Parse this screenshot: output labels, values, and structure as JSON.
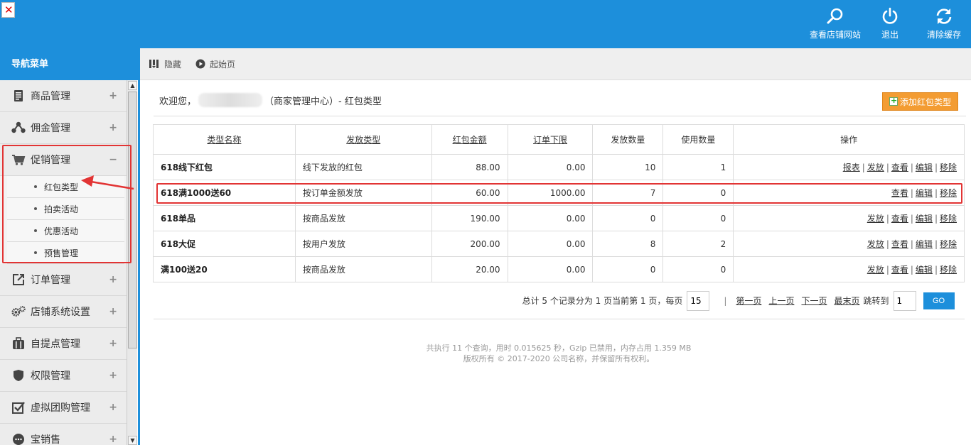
{
  "topbar": {
    "actions": [
      {
        "label": "查看店铺网站",
        "icon": "search-icon"
      },
      {
        "label": "退出",
        "icon": "power-icon"
      },
      {
        "label": "清除缓存",
        "icon": "refresh-icon"
      }
    ]
  },
  "nav": {
    "header": "导航菜单",
    "items": [
      {
        "label": "商品管理",
        "icon": "document-icon",
        "toggle": "+"
      },
      {
        "label": "佣金管理",
        "icon": "share-icon",
        "toggle": "+"
      },
      {
        "label": "促销管理",
        "icon": "cart-icon",
        "toggle": "−"
      },
      {
        "label": "订单管理",
        "icon": "export-icon",
        "toggle": "+"
      },
      {
        "label": "店铺系统设置",
        "icon": "gears-icon",
        "toggle": "+"
      },
      {
        "label": "自提点管理",
        "icon": "briefcase-icon",
        "toggle": "+"
      },
      {
        "label": "权限管理",
        "icon": "shield-icon",
        "toggle": "+"
      },
      {
        "label": "虚拟团购管理",
        "icon": "checkbox-icon",
        "toggle": "+"
      },
      {
        "label": "宝销售",
        "icon": "chat-icon",
        "toggle": "+"
      }
    ],
    "submenu": [
      "红包类型",
      "拍卖活动",
      "优惠活动",
      "预售管理"
    ]
  },
  "toolbar": {
    "hide_label": "隐藏",
    "home_label": "起始页"
  },
  "page": {
    "welcome_prefix": "欢迎您，",
    "welcome_suffix": "（商家管理中心）- 红包类型",
    "add_button": "添加红包类型"
  },
  "table": {
    "headers": [
      "类型名称",
      "发放类型",
      "红包金额",
      "订单下限",
      "发放数量",
      "使用数量",
      "操作"
    ],
    "rows": [
      {
        "name": "618线下红包",
        "type": "线下发放的红包",
        "amount": "88.00",
        "min": "0.00",
        "issued": "10",
        "used": "1",
        "ops": [
          "报表",
          "发放",
          "查看",
          "编辑",
          "移除"
        ]
      },
      {
        "name": "618满1000送60",
        "type": "按订单金额发放",
        "amount": "60.00",
        "min": "1000.00",
        "issued": "7",
        "used": "0",
        "ops": [
          "查看",
          "编辑",
          "移除"
        ]
      },
      {
        "name": "618单品",
        "type": "按商品发放",
        "amount": "190.00",
        "min": "0.00",
        "issued": "0",
        "used": "0",
        "ops": [
          "发放",
          "查看",
          "编辑",
          "移除"
        ]
      },
      {
        "name": "618大促",
        "type": "按用户发放",
        "amount": "200.00",
        "min": "0.00",
        "issued": "8",
        "used": "2",
        "ops": [
          "发放",
          "查看",
          "编辑",
          "移除"
        ]
      },
      {
        "name": "满100送20",
        "type": "按商品发放",
        "amount": "20.00",
        "min": "0.00",
        "issued": "0",
        "used": "0",
        "ops": [
          "发放",
          "查看",
          "编辑",
          "移除"
        ]
      }
    ]
  },
  "pager": {
    "summary": "总计 5 个记录分为 1 页当前第 1 页，每页",
    "per_page": "15",
    "first": "第一页",
    "prev": "上一页",
    "next": "下一页",
    "last": "最末页",
    "jump_label": "跳转到",
    "jump_value": "1",
    "go": "GO"
  },
  "footer": {
    "line1": "共执行 11 个查询，用时 0.015625 秒，Gzip 已禁用，内存占用 1.359 MB",
    "line2": "版权所有 © 2017-2020 公司名称，并保留所有权利。"
  },
  "colors": {
    "brand_blue": "#1d8fdb",
    "accent_orange": "#f39c32",
    "annotation_red": "#e23434"
  }
}
